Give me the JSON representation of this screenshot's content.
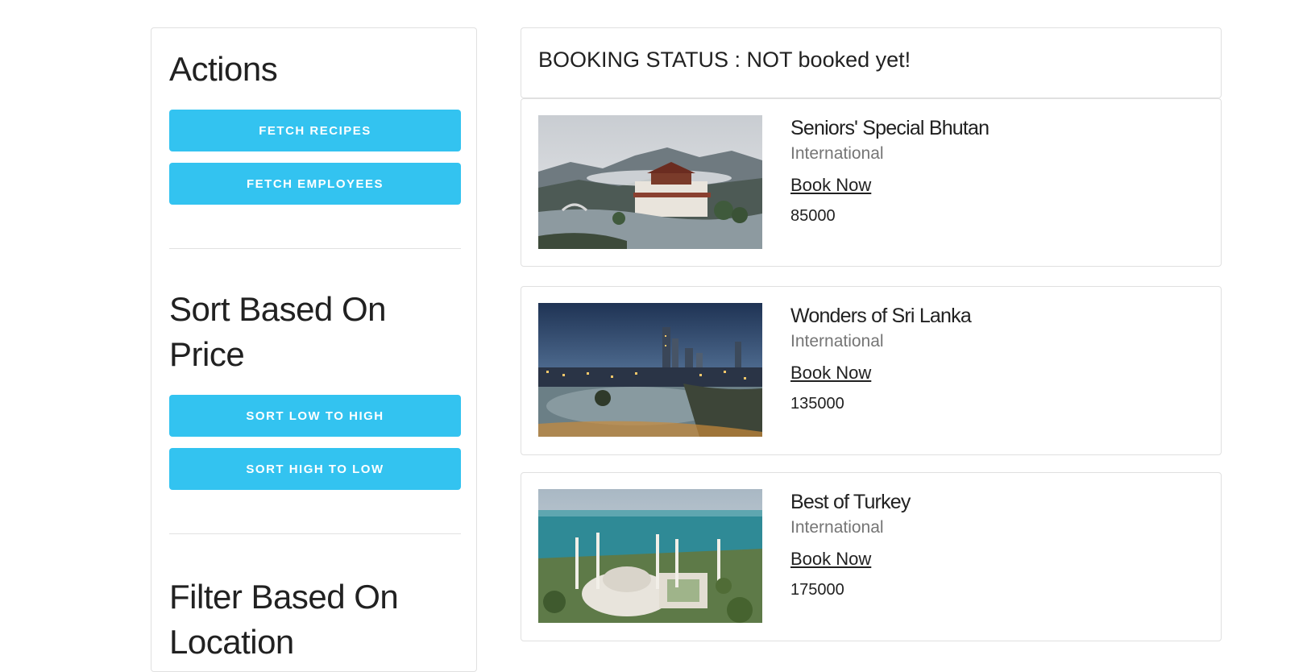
{
  "sidebar": {
    "actions_title": "Actions",
    "fetch_recipes_label": "FETCH RECIPES",
    "fetch_employees_label": "FETCH EMPLOYEES",
    "sort_title": "Sort Based On Price",
    "sort_low_high_label": "SORT LOW TO HIGH",
    "sort_high_low_label": "SORT HIGH TO LOW",
    "filter_title": "Filter Based On Location"
  },
  "booking": {
    "status_text": "BOOKING STATUS : NOT booked yet!"
  },
  "packages": [
    {
      "title": "Seniors' Special Bhutan",
      "type": "International",
      "link_label": "Book Now",
      "price": "85000",
      "image": "bhutan-monastery-photo"
    },
    {
      "title": "Wonders of Sri Lanka",
      "type": "International",
      "link_label": "Book Now",
      "price": "135000",
      "image": "sri-lanka-city-night-photo"
    },
    {
      "title": "Best of Turkey",
      "type": "International",
      "link_label": "Book Now",
      "price": "175000",
      "image": "turkey-mosque-aerial-photo"
    }
  ],
  "colors": {
    "button": "#33c3f0",
    "border": "#e0e0e0",
    "text": "#212121",
    "muted": "#757575"
  }
}
